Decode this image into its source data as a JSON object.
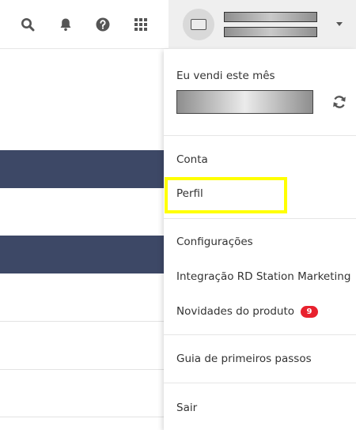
{
  "header": {
    "icons": [
      "search-icon",
      "bell-icon",
      "help-icon",
      "apps-grid-icon",
      "chevron-down-icon"
    ]
  },
  "user": {
    "name_redacted": true
  },
  "menu": {
    "sold_label": "Eu vendi este mês",
    "items": {
      "conta": "Conta",
      "perfil": "Perfil",
      "configuracoes": "Configurações",
      "integracao": "Integração RD Station Marketing",
      "novidades": "Novidades do produto",
      "novidades_badge": "9",
      "guia": "Guia de primeiros passos",
      "sair": "Sair"
    }
  },
  "colors": {
    "highlight": "#ffff00",
    "badge": "#e8212e",
    "band": "#3d4866"
  }
}
